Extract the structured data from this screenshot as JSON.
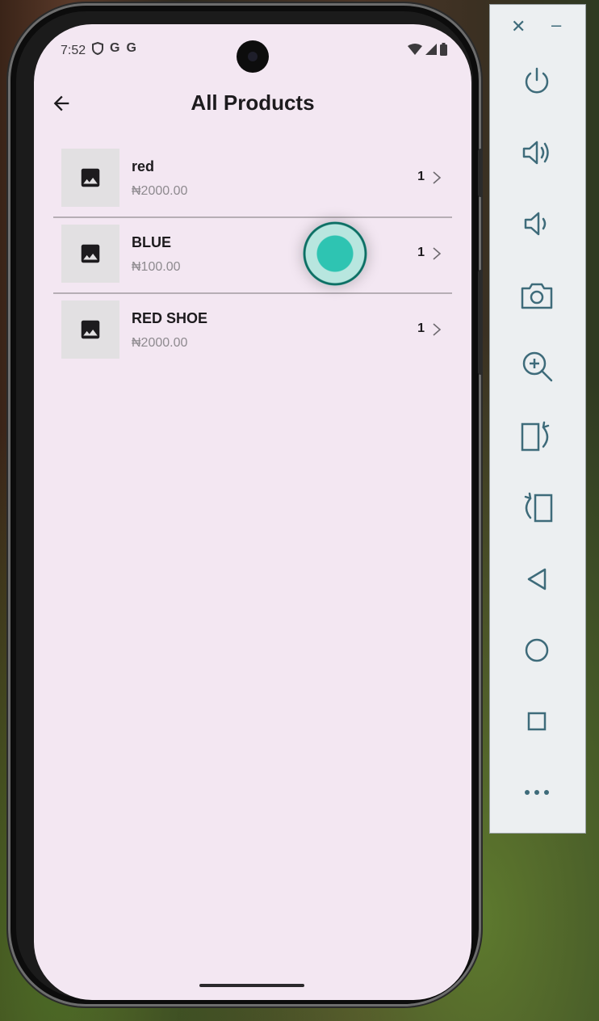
{
  "status_bar": {
    "time": "7:52",
    "notification_icons": [
      "shield-icon",
      "google-icon",
      "google-icon"
    ],
    "google_glyph": "G",
    "right_icons": [
      "wifi-icon",
      "signal-icon",
      "battery-icon"
    ]
  },
  "app_bar": {
    "title": "All Products",
    "back_icon": "arrow-back-icon"
  },
  "products": [
    {
      "name": "red",
      "price": "₦2000.00",
      "quantity": "1",
      "thumb_icon": "image-placeholder-icon"
    },
    {
      "name": "BLUE",
      "price": "₦100.00",
      "quantity": "1",
      "thumb_icon": "image-placeholder-icon"
    },
    {
      "name": "RED SHOE",
      "price": "₦2000.00",
      "quantity": "1",
      "thumb_icon": "image-placeholder-icon"
    }
  ],
  "emulator_toolbar": {
    "close_glyph": "✕",
    "minimize_glyph": "–",
    "buttons": [
      "power-icon",
      "volume-up-icon",
      "volume-down-icon",
      "camera-icon",
      "zoom-in-icon",
      "rotate-left-icon",
      "rotate-right-icon",
      "back-triangle-icon",
      "home-circle-icon",
      "overview-square-icon",
      "more-icon"
    ]
  },
  "colors": {
    "screen_background": "#f3e7f2",
    "divider": "#b6aeb5",
    "price_text": "#8e8a8f",
    "thumb_background": "#e2e0e2",
    "toolbar_icon": "#3e6b7a",
    "touch_indicator": "#2ec4b2"
  }
}
